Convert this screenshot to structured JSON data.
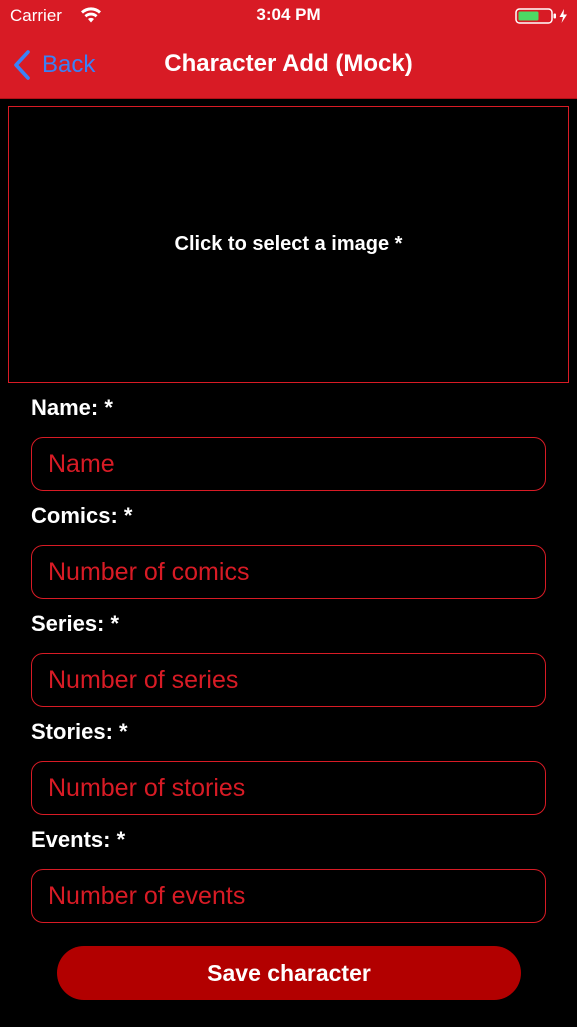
{
  "colors": {
    "header_bg": "#d81b25",
    "accent": "#d81b25",
    "back_tint": "#3a82f7",
    "button_bg": "#b20000",
    "background": "#000000"
  },
  "status_bar": {
    "carrier": "Carrier",
    "time": "3:04 PM",
    "wifi_icon": "wifi-icon",
    "battery_icon": "battery-charging-icon"
  },
  "nav": {
    "back_label": "Back",
    "back_icon": "chevron-left-icon",
    "title": "Character Add (Mock)"
  },
  "image_picker": {
    "label": "Click to select a image *"
  },
  "form": {
    "name": {
      "label": "Name: *",
      "placeholder": "Name",
      "value": ""
    },
    "comics": {
      "label": "Comics: *",
      "placeholder": "Number of comics",
      "value": ""
    },
    "series": {
      "label": "Series: *",
      "placeholder": "Number of series",
      "value": ""
    },
    "stories": {
      "label": "Stories: *",
      "placeholder": "Number of stories",
      "value": ""
    },
    "events": {
      "label": "Events: *",
      "placeholder": "Number of events",
      "value": ""
    }
  },
  "save_button": {
    "label": "Save character"
  }
}
